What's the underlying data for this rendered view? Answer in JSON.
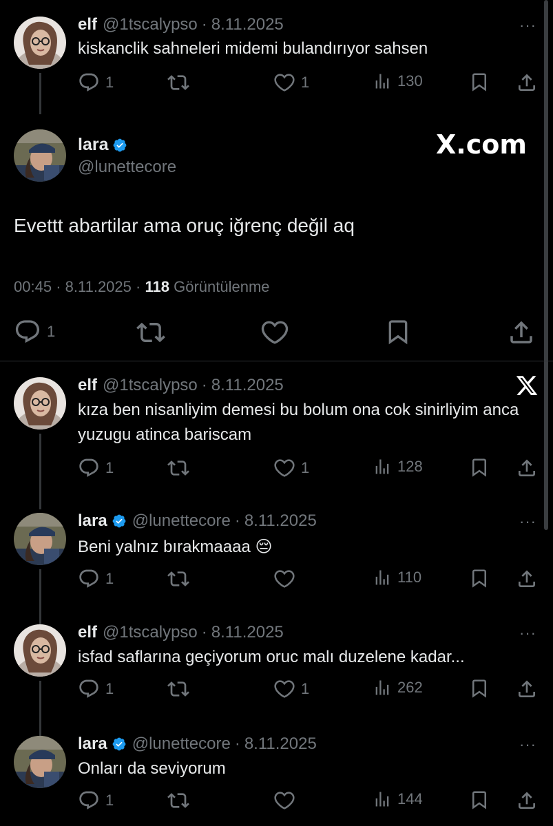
{
  "colors": {
    "background": "#000000",
    "text": "#e7e9ea",
    "muted": "#71767b",
    "verified": "#1d9bf0",
    "divider": "#2f3336"
  },
  "watermark": {
    "site": "X.com",
    "logo_icon": "x-logo-icon"
  },
  "focused_tweet": {
    "name": "lara",
    "handle": "@lunettecore",
    "text": "Evettt abartilar ama oruç iğrenç değil aq",
    "time": "00:45",
    "date": "8.11.2025",
    "views": "118",
    "views_label": "Görüntülenme",
    "reply_count": "1"
  },
  "replies": [
    {
      "name": "elf",
      "handle": "@1tscalypso",
      "date": "8.11.2025",
      "text": "kiskanclik sahneleri midemi bulandırıyor sahsen",
      "replies": "1",
      "reposts": "",
      "likes": "1",
      "views": "130"
    },
    {
      "name": "elf",
      "handle": "@1tscalypso",
      "date": "8.11.2025",
      "text": "kıza ben nisanliyim demesi bu bolum ona cok sinirliyim anca yuzugu atinca bariscam",
      "replies": "1",
      "reposts": "",
      "likes": "1",
      "views": "128"
    },
    {
      "name": "lara",
      "handle": "@lunettecore",
      "date": "8.11.2025",
      "text": "Beni yalnız bırakmaaaa 😔",
      "replies": "1",
      "reposts": "",
      "likes": "",
      "views": "110"
    },
    {
      "name": "elf",
      "handle": "@1tscalypso",
      "date": "8.11.2025",
      "text": "isfad saflarına geçiyorum oruc malı duzelene kadar...",
      "replies": "1",
      "reposts": "",
      "likes": "1",
      "views": "262"
    },
    {
      "name": "lara",
      "handle": "@lunettecore",
      "date": "8.11.2025",
      "text": "Onları da seviyorum",
      "replies": "1",
      "reposts": "",
      "likes": "",
      "views": "144"
    }
  ],
  "separator": "·",
  "more_label": "···"
}
